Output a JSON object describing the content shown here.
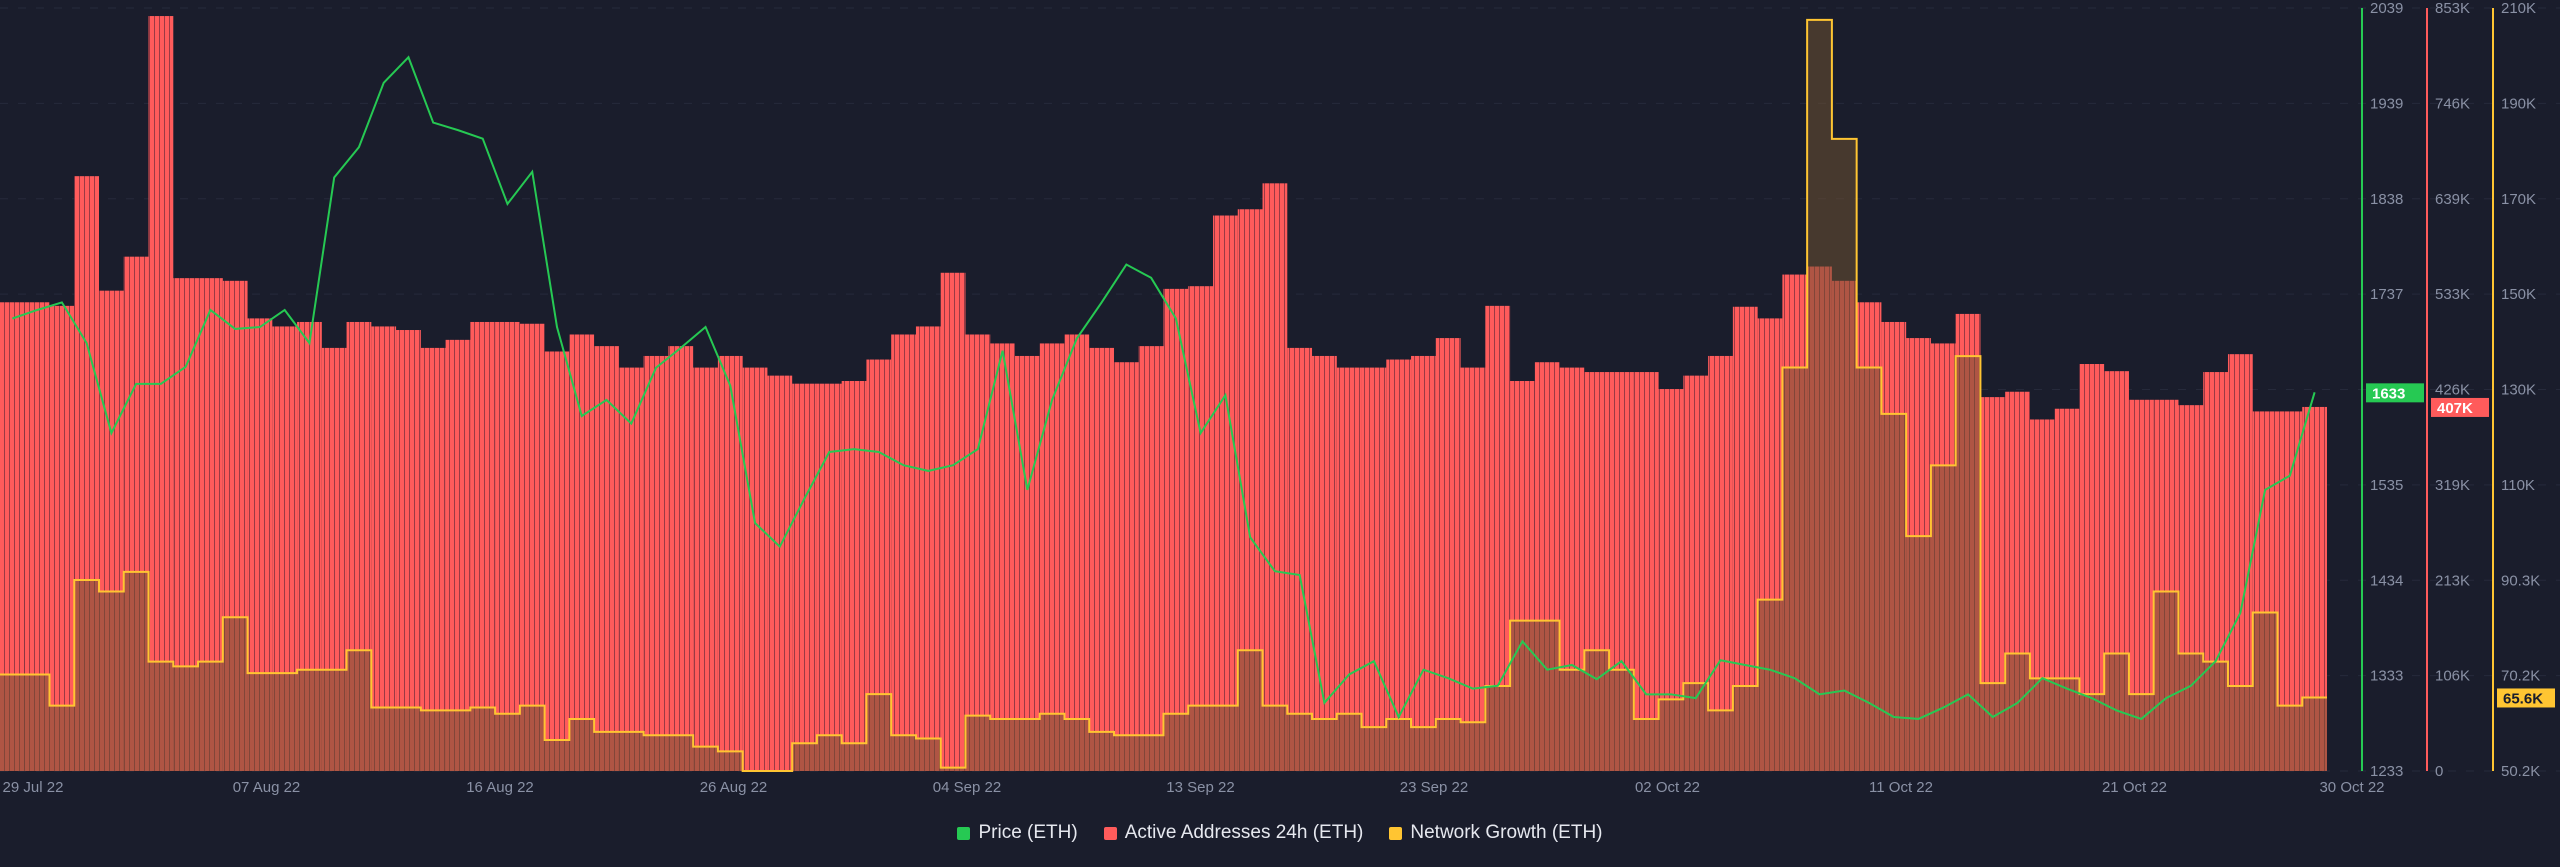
{
  "chart_data": {
    "type": "bar+line",
    "grid": true,
    "legend_position": "bottom",
    "x_tick_labels": [
      "29 Jul 22",
      "07 Aug 22",
      "16 Aug 22",
      "26 Aug 22",
      "04 Sep 22",
      "13 Sep 22",
      "23 Sep 22",
      "02 Oct 22",
      "11 Oct 22",
      "21 Oct 22",
      "30 Oct 22"
    ],
    "dates": [
      "2022-07-29",
      "2022-07-30",
      "2022-07-31",
      "2022-08-01",
      "2022-08-02",
      "2022-08-03",
      "2022-08-04",
      "2022-08-05",
      "2022-08-06",
      "2022-08-07",
      "2022-08-08",
      "2022-08-09",
      "2022-08-10",
      "2022-08-11",
      "2022-08-12",
      "2022-08-13",
      "2022-08-14",
      "2022-08-15",
      "2022-08-16",
      "2022-08-17",
      "2022-08-18",
      "2022-08-19",
      "2022-08-20",
      "2022-08-21",
      "2022-08-22",
      "2022-08-23",
      "2022-08-24",
      "2022-08-25",
      "2022-08-26",
      "2022-08-27",
      "2022-08-28",
      "2022-08-29",
      "2022-08-30",
      "2022-08-31",
      "2022-09-01",
      "2022-09-02",
      "2022-09-03",
      "2022-09-04",
      "2022-09-05",
      "2022-09-06",
      "2022-09-07",
      "2022-09-08",
      "2022-09-09",
      "2022-09-10",
      "2022-09-11",
      "2022-09-12",
      "2022-09-13",
      "2022-09-14",
      "2022-09-15",
      "2022-09-16",
      "2022-09-17",
      "2022-09-18",
      "2022-09-19",
      "2022-09-20",
      "2022-09-21",
      "2022-09-22",
      "2022-09-23",
      "2022-09-24",
      "2022-09-25",
      "2022-09-26",
      "2022-09-27",
      "2022-09-28",
      "2022-09-29",
      "2022-09-30",
      "2022-10-01",
      "2022-10-02",
      "2022-10-03",
      "2022-10-04",
      "2022-10-05",
      "2022-10-06",
      "2022-10-07",
      "2022-10-08",
      "2022-10-09",
      "2022-10-10",
      "2022-10-11",
      "2022-10-12",
      "2022-10-13",
      "2022-10-14",
      "2022-10-15",
      "2022-10-16",
      "2022-10-17",
      "2022-10-18",
      "2022-10-19",
      "2022-10-20",
      "2022-10-21",
      "2022-10-22",
      "2022-10-23",
      "2022-10-24",
      "2022-10-25",
      "2022-10-26",
      "2022-10-27",
      "2022-10-28",
      "2022-10-29",
      "2022-10-30"
    ],
    "axes": {
      "price": {
        "ticks": [
          "2039",
          "1939",
          "1838",
          "1737",
          "1633",
          "1535",
          "1434",
          "1333",
          "1233"
        ],
        "tick_values": [
          2039,
          1939,
          1838,
          1737,
          1636,
          1535,
          1434,
          1333,
          1233
        ],
        "range": [
          1233,
          2039
        ],
        "color": "#26c953"
      },
      "active": {
        "ticks": [
          "853K",
          "746K",
          "639K",
          "533K",
          "426K",
          "319K",
          "213K",
          "106K",
          "0"
        ],
        "range": [
          0,
          853
        ],
        "color": "#ff5b5b"
      },
      "growth": {
        "ticks": [
          "210K",
          "190K",
          "170K",
          "150K",
          "130K",
          "110K",
          "90.3K",
          "70.2K",
          "50.2K"
        ],
        "range": [
          50.2,
          210
        ],
        "color": "#ffc532"
      }
    },
    "series": [
      {
        "name": "Price (ETH)",
        "type": "line",
        "axis": "price",
        "color": "#26c953",
        "last_label": "1633",
        "values": [
          1711,
          1720,
          1728,
          1685,
          1590,
          1642,
          1642,
          1660,
          1720,
          1700,
          1702,
          1720,
          1685,
          1860,
          1892,
          1960,
          1987,
          1918,
          1910,
          1901,
          1832,
          1866,
          1702,
          1608,
          1625,
          1600,
          1659,
          1680,
          1702,
          1640,
          1495,
          1470,
          1521,
          1570,
          1573,
          1570,
          1556,
          1550,
          1556,
          1573,
          1677,
          1530,
          1625,
          1690,
          1728,
          1768,
          1754,
          1711,
          1590,
          1630,
          1480,
          1444,
          1440,
          1305,
          1335,
          1349,
          1290,
          1340,
          1331,
          1320,
          1323,
          1370,
          1340,
          1345,
          1330,
          1349,
          1314,
          1314,
          1310,
          1350,
          1345,
          1340,
          1331,
          1314,
          1318,
          1305,
          1290,
          1288,
          1300,
          1314,
          1290,
          1305,
          1331,
          1320,
          1310,
          1297,
          1288,
          1310,
          1323,
          1349,
          1400,
          1530,
          1545,
          1633
        ]
      },
      {
        "name": "Active Addresses 24h (ETH)",
        "type": "bar",
        "axis": "active",
        "color": "#ff5b5b",
        "last_label": "407K",
        "values": [
          524,
          524,
          520,
          665,
          537,
          575,
          844,
          551,
          551,
          548,
          506,
          497,
          502,
          473,
          502,
          497,
          493,
          473,
          482,
          502,
          502,
          500,
          469,
          488,
          475,
          451,
          464,
          475,
          451,
          464,
          451,
          442,
          433,
          433,
          436,
          460,
          488,
          497,
          557,
          488,
          478,
          464,
          478,
          488,
          473,
          457,
          475,
          539,
          542,
          621,
          628,
          657,
          473,
          464,
          451,
          451,
          460,
          464,
          484,
          451,
          520,
          436,
          457,
          451,
          446,
          446,
          446,
          427,
          442,
          464,
          519,
          506,
          555,
          564,
          548,
          524,
          502,
          484,
          478,
          511,
          418,
          424,
          393,
          405,
          455,
          447,
          415,
          415,
          409,
          446,
          466,
          402,
          402,
          407
        ]
      },
      {
        "name": "Network Growth (ETH)",
        "type": "step-area",
        "axis": "growth",
        "color": "#ffc532",
        "last_label": "65.6K",
        "values": [
          70.4,
          70.4,
          63.9,
          90.2,
          87.8,
          91.9,
          73.1,
          72.1,
          73.1,
          82.4,
          70.7,
          70.7,
          71.4,
          71.4,
          75.5,
          63.5,
          63.5,
          62.9,
          62.9,
          63.5,
          62.2,
          63.9,
          56.7,
          61.1,
          58.4,
          58.4,
          57.7,
          57.7,
          55.3,
          54.3,
          50.2,
          50.2,
          56,
          57.7,
          56,
          66.3,
          57.7,
          57,
          50.9,
          61.8,
          61.1,
          61.1,
          62.2,
          61.1,
          58.4,
          57.7,
          57.7,
          62.2,
          63.9,
          63.9,
          75.5,
          63.9,
          62.2,
          61.1,
          62.2,
          59.4,
          61.1,
          59.4,
          61.1,
          60.4,
          68,
          81.7,
          81.7,
          71.4,
          75.5,
          71.4,
          61.1,
          65.2,
          68.6,
          62.9,
          68,
          86.1,
          134.7,
          207.5,
          182.6,
          134.7,
          125,
          99.4,
          114.2,
          137.1,
          68.6,
          74.8,
          69.6,
          69.6,
          66.3,
          74.8,
          66.3,
          87.8,
          74.8,
          73.1,
          68,
          83.4,
          63.9,
          65.6
        ]
      }
    ]
  },
  "legend": {
    "items": [
      {
        "label": "Price (ETH)",
        "color": "#26c953"
      },
      {
        "label": "Active Addresses 24h (ETH)",
        "color": "#ff5b5b"
      },
      {
        "label": "Network Growth (ETH)",
        "color": "#ffc532"
      }
    ]
  }
}
